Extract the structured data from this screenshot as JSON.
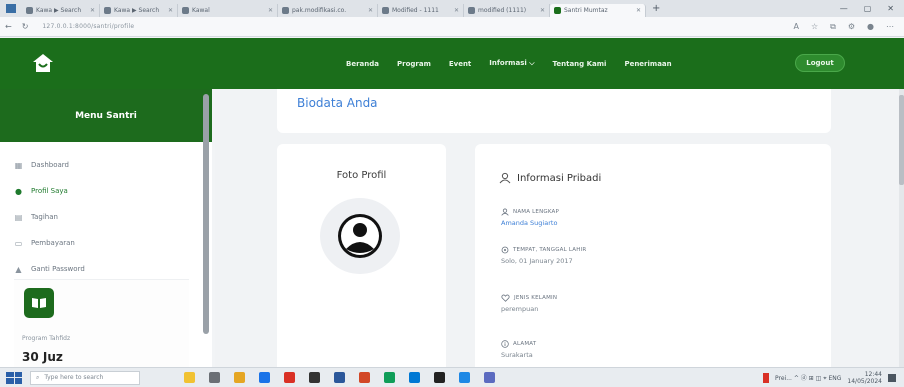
{
  "browser": {
    "tabs": [
      {
        "title": "Kawa ▶ Search",
        "active": false
      },
      {
        "title": "Kawa ▶ Search",
        "active": false
      },
      {
        "title": "Kawal",
        "active": false
      },
      {
        "title": "pak.modifikasi.co.",
        "active": false
      },
      {
        "title": "Modified - 1111",
        "active": false
      },
      {
        "title": "modified (1111)",
        "active": false
      },
      {
        "title": "Santri Mumtaz",
        "active": true
      }
    ],
    "url": "127.0.0.1:8000/santri/profile"
  },
  "navbar": {
    "menu": [
      "Beranda",
      "Program",
      "Event",
      "Informasi ⌵",
      "Tentang Kami",
      "Penerimaan"
    ],
    "logout_label": "Logout",
    "brand_color": "#1b6e1b"
  },
  "sidebar": {
    "title": "Menu Santri",
    "items": [
      {
        "label": "Dashboard",
        "icon": "grid-icon",
        "active": false
      },
      {
        "label": "Profil Saya",
        "icon": "user-icon",
        "active": true
      },
      {
        "label": "Tagihan",
        "icon": "document-icon",
        "active": false
      },
      {
        "label": "Pembayaran",
        "icon": "card-icon",
        "active": false
      },
      {
        "label": "Ganti Password",
        "icon": "lock-icon",
        "active": false
      }
    ],
    "hafidz_label": "Program Tahfidz",
    "hafidz_value": "30 Juz"
  },
  "main": {
    "biodata_title": "Biodata Anda",
    "photo_title": "Foto Profil",
    "info_title": "Informasi Pribadi",
    "fields": [
      {
        "label": "NAMA LENGKAP",
        "value": "Amanda Sugiarto",
        "icon": "user-icon"
      },
      {
        "label": "TEMPAT, TANGGAL LAHIR",
        "value": "Solo, 01 January 2017",
        "icon": "location-icon"
      },
      {
        "label": "JENIS KELAMIN",
        "value": "perempuan",
        "icon": "heart-icon"
      },
      {
        "label": "ALAMAT",
        "value": "Surakarta",
        "icon": "info-icon"
      }
    ]
  },
  "taskbar": {
    "search_placeholder": "Type here to search",
    "tray_text": "Prei... ^ ⓓ ⊞ ◫ ⌖ ENG",
    "time": "12:44",
    "date": "14/05/2024"
  }
}
